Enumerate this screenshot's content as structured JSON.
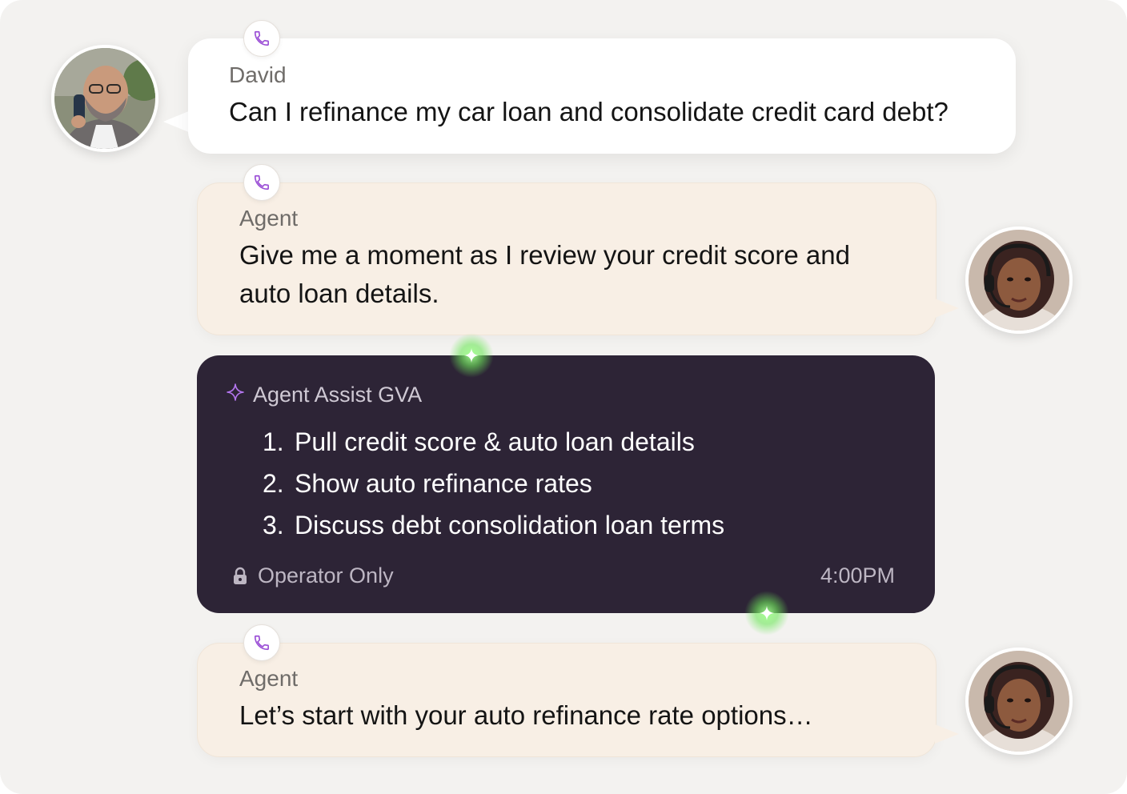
{
  "conversation": {
    "customer_message": {
      "speaker": "David",
      "text": "Can I refinance my car loan and consolidate credit card debt?"
    },
    "agent_message_1": {
      "speaker": "Agent",
      "text": "Give me a moment as I review your credit score and auto loan details."
    },
    "assist_card": {
      "title": "Agent Assist GVA",
      "steps": [
        {
          "num": "1.",
          "text": "Pull credit score & auto loan details"
        },
        {
          "num": "2.",
          "text": "Show auto refinance rates"
        },
        {
          "num": "3.",
          "text": "Discuss debt consolidation loan terms"
        }
      ],
      "visibility": "Operator Only",
      "time": "4:00PM"
    },
    "agent_message_2": {
      "speaker": "Agent",
      "text": "Let’s start with your auto refinance rate options…"
    }
  },
  "colors": {
    "background": "#f3f2f0",
    "customer_bubble": "#ffffff",
    "agent_bubble": "#f8efe5",
    "assist_card": "#2d2436",
    "accent_purple": "#9b4fd6",
    "glow_green": "#7be363"
  },
  "icons": {
    "channel": "phone-icon",
    "assist": "sparkle-icon",
    "visibility": "lock-icon",
    "glow": "green-sparkle-icon"
  }
}
